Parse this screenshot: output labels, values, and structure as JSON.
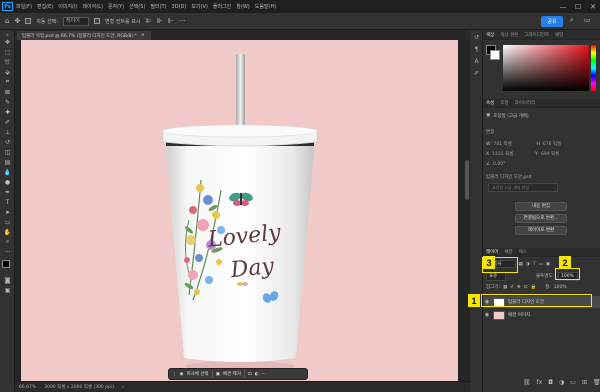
{
  "app": {
    "logo": "Ps"
  },
  "menu": [
    "파일(F)",
    "편집(E)",
    "이미지(I)",
    "레이어(L)",
    "문자(Y)",
    "선택(S)",
    "필터(T)",
    "3D(D)",
    "보기(V)",
    "플러그인",
    "창(W)",
    "도움말(H)"
  ],
  "window_controls": {
    "minimize": "—",
    "maximize": "☐",
    "close": "✕"
  },
  "options_bar": {
    "auto_select_label": "자동 선택:",
    "auto_select_value": "레이어",
    "transform_label": "변형 컨트롤 표시",
    "share_button": "공유"
  },
  "document_tab": {
    "title": "텀블러 목업.psd @ 66.7% (텀블러 디자인 도안, RGB/8) *",
    "close": "×"
  },
  "canvas": {
    "background": "#f1c9c9",
    "design_line1": "Lovely",
    "design_line2": "Day"
  },
  "status_bar": {
    "zoom": "66.67%",
    "size": "3000 픽셀 x 2000 픽셀 (300 ppi)"
  },
  "context_bar": {
    "select_subject": "피사체 선택",
    "remove_bg": "배경 제거",
    "more": "···"
  },
  "color_panel": {
    "tabs": [
      "색상",
      "색상 견본",
      "그레이디언트",
      "패턴"
    ]
  },
  "properties_panel": {
    "tabs": [
      "속성",
      "조정",
      "라이브러리"
    ],
    "layer_type": "고급 개체",
    "embedded": "포함됨 (고급 개체)",
    "section_transform": "변형",
    "w_label": "W",
    "w_value": "781 픽셀",
    "h_label": "H",
    "h_value": "676 픽셀",
    "x_label": "X",
    "x_value": "1155 픽셀",
    "y_label": "Y",
    "y_value": "699 픽셀",
    "angle": "0.00°",
    "linked_file": "텀블러 디자인 도안.psd",
    "linked_file_path": "포함된 고급 개체 파일",
    "btn_edit": "내용 편집",
    "btn_convert": "연결됨으로 변환...",
    "btn_convert_layers": "레이어로 변환"
  },
  "layers_panel": {
    "tabs": [
      "레이어",
      "채널",
      "패스"
    ],
    "filter_label": "종류",
    "blend_mode": "표준",
    "opacity_label": "불투명도:",
    "opacity_value": "100%",
    "lock_label": "잠그기:",
    "fill_label": "칠:",
    "fill_value": "100%",
    "layers": [
      {
        "name": "텀블러 디자인 도안",
        "selected": true,
        "swatch": "#ffffff"
      },
      {
        "name": "배경 이미지",
        "selected": false,
        "swatch": "#f1c9c9"
      }
    ]
  },
  "callouts": [
    "1",
    "2",
    "3"
  ]
}
